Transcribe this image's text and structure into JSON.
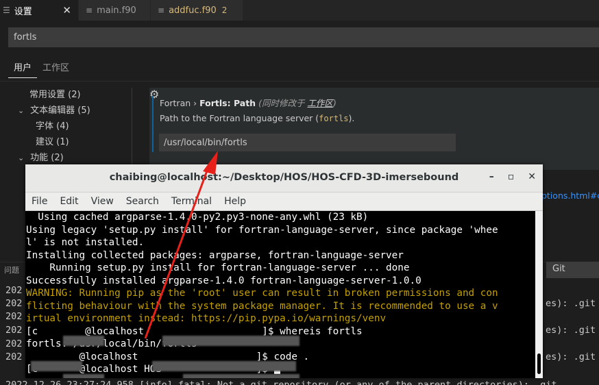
{
  "tabs": [
    {
      "label": "设置",
      "active": true
    },
    {
      "label": "main.f90"
    },
    {
      "label": "addfuc.f90",
      "badge": "2"
    }
  ],
  "search": {
    "value": "fortls"
  },
  "scope_tabs": [
    "用户",
    "工作区"
  ],
  "toc": [
    {
      "label": "常用设置 (2)",
      "chevron": ""
    },
    {
      "label": "文本编辑器 (5)",
      "chevron": "⌄"
    },
    {
      "label": "字体 (4)",
      "chevron": ""
    },
    {
      "label": "建议 (1)",
      "chevron": ""
    },
    {
      "label": "功能 (2)",
      "chevron": "⌄"
    }
  ],
  "setting": {
    "category": "Fortran › ",
    "name": "Fortls: Path",
    "modified_prefix": " (同时修改于 ",
    "modified_link": "工作区",
    "modified_suffix": ")",
    "desc_prefix": "Path to the Fortran language server (",
    "desc_code": "fortls",
    "desc_suffix": ").",
    "value": "/usr/local/bin/fortls"
  },
  "right_link": "ptions.html#con",
  "panel": {
    "tab": "问题",
    "select": "Git"
  },
  "output_lines": [
    {
      "text": "202",
      "suffix": ""
    },
    {
      "text": "202",
      "suffix": "es): .git"
    },
    {
      "text": "202",
      "suffix": ""
    },
    {
      "text": "202",
      "suffix": "es): .git"
    },
    {
      "text": "202",
      "suffix": ""
    },
    {
      "text": "202",
      "suffix": "es): .git"
    },
    {
      "text": "2022-12-26 23:27:24.958 [info] fatal: Not a git repository (or any of the parent directories): .git",
      "suffix": ""
    }
  ],
  "terminal": {
    "title": "chaibing@localhost:~/Desktop/HOS/HOS-CFD-3D-imersebound",
    "menu": [
      "File",
      "Edit",
      "View",
      "Search",
      "Terminal",
      "Help"
    ],
    "lines": [
      {
        "text": "  Using cached argparse-1.4.0-py2.py3-none-any.whl (23 kB)",
        "warn": false
      },
      {
        "text": "Using legacy 'setup.py install' for fortran-language-server, since package 'whee",
        "warn": false
      },
      {
        "text": "l' is not installed.",
        "warn": false
      },
      {
        "text": "Installing collected packages: argparse, fortran-language-server",
        "warn": false
      },
      {
        "text": "    Running setup.py install for fortran-language-server ... done",
        "warn": false
      },
      {
        "text": "Successfully installed argparse-1.4.0 fortran-language-server-1.0.0",
        "warn": false
      },
      {
        "text": "WARNING: Running pip as the 'root' user can result in broken permissions and con",
        "warn": true
      },
      {
        "text": "flicting behaviour with the system package manager. It is recommended to use a v",
        "warn": true
      },
      {
        "text": "irtual environment instead: https://pip.pypa.io/warnings/venv",
        "warn": true
      },
      {
        "text": "[c        @localhost                    ]$ whereis fortls",
        "warn": false
      },
      {
        "text": "fortls: /usr/local/bin/fortls",
        "warn": false
      },
      {
        "text": "         @localhost                    ]$ code .",
        "warn": false
      },
      {
        "text": "[c       @localhost HOS                ]$ ",
        "warn": false,
        "cursor": true
      }
    ]
  },
  "colors": {
    "accent": "#0e639c",
    "warning": "#c4a000",
    "annotation_arrow": "#e8201a"
  }
}
